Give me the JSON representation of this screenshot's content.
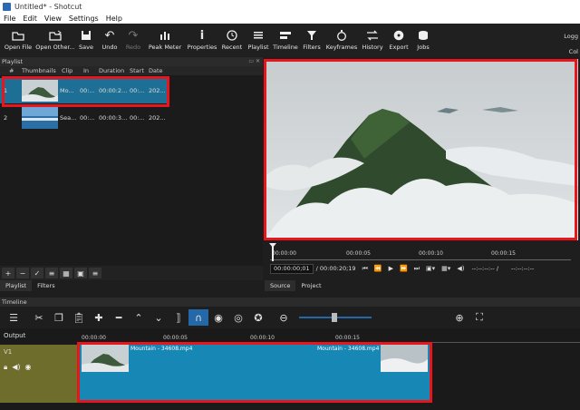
{
  "window": {
    "title": "Untitled* - Shotcut"
  },
  "menu": [
    "File",
    "Edit",
    "View",
    "Settings",
    "Help"
  ],
  "toolbar": {
    "items": [
      {
        "label": "Open File",
        "icon": "folder-open-icon"
      },
      {
        "label": "Open Other...",
        "icon": "open-other-icon"
      },
      {
        "label": "Save",
        "icon": "save-icon"
      },
      {
        "label": "Undo",
        "icon": "undo-icon"
      },
      {
        "label": "Redo",
        "icon": "redo-icon"
      },
      {
        "label": "Peak Meter",
        "icon": "peak-meter-icon"
      },
      {
        "label": "Properties",
        "icon": "info-icon"
      },
      {
        "label": "Recent",
        "icon": "clock-icon"
      },
      {
        "label": "Playlist",
        "icon": "list-icon"
      },
      {
        "label": "Timeline",
        "icon": "timeline-icon"
      },
      {
        "label": "Filters",
        "icon": "filter-icon"
      },
      {
        "label": "Keyframes",
        "icon": "stopwatch-icon"
      },
      {
        "label": "History",
        "icon": "history-icon"
      },
      {
        "label": "Export",
        "icon": "export-icon"
      },
      {
        "label": "Jobs",
        "icon": "jobs-icon"
      }
    ],
    "right_top": "Logg",
    "right_bottom": "Col"
  },
  "playlist": {
    "title": "Playlist",
    "dock_icons": "▭ ✕",
    "columns": [
      "#",
      "Thumbnails",
      "Clip",
      "In",
      "Duration",
      "Start",
      "Date"
    ],
    "rows": [
      {
        "num": "1",
        "clip": "Mo...",
        "in": "00:...",
        "duration": "00:00:2...",
        "start": "00:...",
        "date": "202..."
      },
      {
        "num": "2",
        "clip": "Sea...",
        "in": "00:...",
        "duration": "00:00:3...",
        "start": "00:...",
        "date": "202..."
      }
    ],
    "controls": [
      "+",
      "−",
      "✓",
      "≡",
      "▦",
      "▣",
      "≡"
    ],
    "tabs": [
      "Playlist",
      "Filters"
    ]
  },
  "viewer": {
    "ticks": [
      "00:00:00",
      "00:00:05",
      "00:00:10",
      "00:00:15"
    ],
    "current_time": "00:00:00;01",
    "duration": "/ 00:00:20;19",
    "in_out_left": "--:--:--:-- /",
    "in_out_right": "--:--:--:--",
    "tabs": [
      "Source",
      "Project"
    ]
  },
  "timeline": {
    "title": "Timeline",
    "output_label": "Output",
    "ticks": [
      "00:00:00",
      "00:00:05",
      "00:00:10",
      "00:00:15"
    ],
    "track_name": "V1",
    "clip_label_left": "Mountain - 34608.mp4",
    "clip_label_right": "Mountain - 34608.mp4"
  },
  "colors": {
    "accent": "#1d6f95",
    "highlight": "#e8161c",
    "clip": "#1787b5",
    "track": "#6e6d2c"
  }
}
